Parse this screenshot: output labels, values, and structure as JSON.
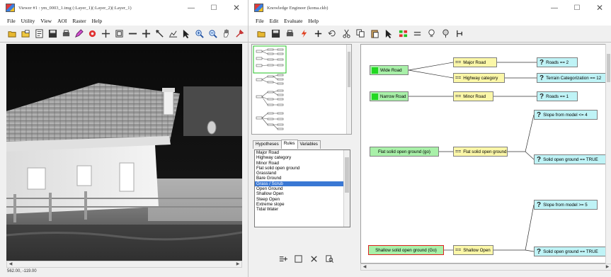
{
  "viewer": {
    "title": "Viewer #1 : ym_0003_1.img (:Layer_1)(:Layer_2)(:Layer_1)",
    "menu": [
      "File",
      "Utility",
      "View",
      "AOI",
      "Raster",
      "Help"
    ],
    "coords": "562.00, -119.00"
  },
  "ke": {
    "title": "Knowledge Engineer (koma.ckb)",
    "menu": [
      "File",
      "Edit",
      "Evaluate",
      "Help"
    ],
    "tabs": [
      "Hypotheses",
      "Rules",
      "Variables"
    ],
    "active_tab": "Rules",
    "rules": [
      "Major Road",
      "Highway category",
      "Minor Road",
      "Flat solid open ground",
      "Grassland",
      "Bare Ground",
      "Grass / Scrub",
      "Open Ground",
      "Shallow Open",
      "Steep Open",
      "Extreme slope",
      "Tidal Water"
    ],
    "selected_rule": "Grass / Scrub",
    "nodes": {
      "wide_road": "Wide Road",
      "narrow_road": "Narrow Road",
      "flat_solid": "Flat solid open ground (go)",
      "shallow_solid": "Shallow solid open ground (Go)",
      "major_road": "Major Road",
      "highway_category": "Highway category",
      "minor_road": "Minor Road",
      "flat_solid_rule": "Flat solid open ground",
      "shallow_open": "Shallow Open",
      "roads_2": "Roads == 2",
      "terrain_12": "Terrain Categorization == 12",
      "roads_1": "Roads == 1",
      "slope_le4": "Slope from model <= 4",
      "solid_true_1": "Solid open ground == TRUE",
      "slope_ge5": "Slope from model >= 5",
      "solid_true_2": "Solid open ground == TRUE"
    }
  },
  "colors": {
    "hypothesis": "#a8f0a8",
    "rule": "#fbf7a8",
    "condition": "#bff3f6",
    "selection": "#3a78d4"
  }
}
